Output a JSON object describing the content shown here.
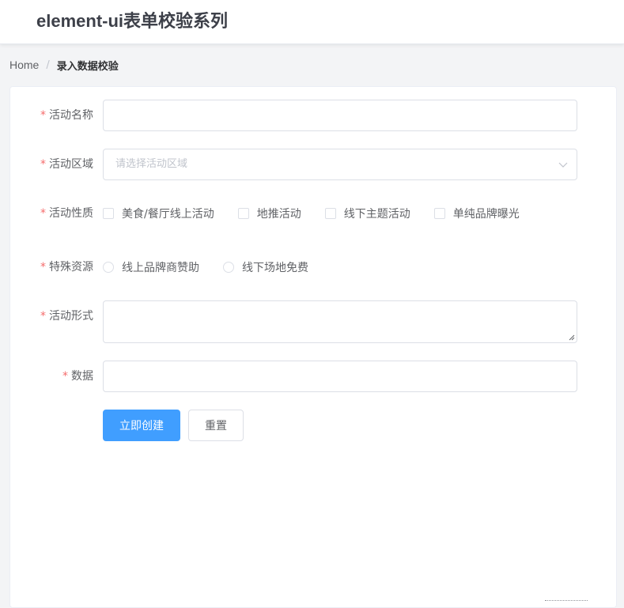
{
  "header": {
    "title": "element-ui表单校验系列"
  },
  "breadcrumb": {
    "home": "Home",
    "separator": "/",
    "current": "录入数据校验"
  },
  "form": {
    "name": {
      "label": "活动名称",
      "value": ""
    },
    "region": {
      "label": "活动区域",
      "placeholder": "请选择活动区域",
      "icon": "chevron-down-icon"
    },
    "type": {
      "label": "活动性质",
      "options": [
        "美食/餐厅线上活动",
        "地推活动",
        "线下主题活动",
        "单纯品牌曝光"
      ]
    },
    "resource": {
      "label": "特殊资源",
      "options": [
        "线上品牌商赞助",
        "线下场地免费"
      ]
    },
    "desc": {
      "label": "活动形式",
      "value": ""
    },
    "data": {
      "label": "数据",
      "value": ""
    },
    "required_mark": "*",
    "buttons": {
      "submit": "立即创建",
      "reset": "重置"
    }
  },
  "colors": {
    "primary": "#409eff",
    "required": "#f56c6c",
    "border": "#dcdfe6",
    "placeholder": "#c0c4cc"
  }
}
